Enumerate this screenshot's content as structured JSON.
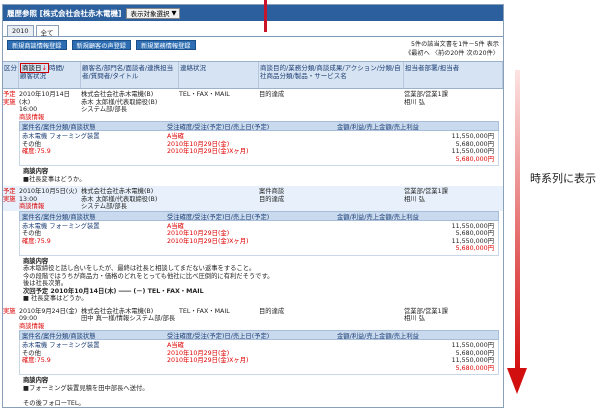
{
  "window": {
    "title": "履歴参照 [株式会社会社赤木電機]",
    "select_label": "表示対象選択"
  },
  "tabs": [
    "2010",
    "全て"
  ],
  "toolbar": {
    "buttons": [
      "新規商談情報登録",
      "新規顧客の声登録",
      "新規業務情報登録"
    ],
    "count": "5件の該当文書を1件－5件 表示",
    "nav": "《最初へ 〈前の20件 次の20件〉"
  },
  "header": {
    "col_kubun": "区分",
    "col_date_label": "商談日",
    "col_date_rest": "時間/",
    "col_status": "顧客状況",
    "col_customer": "顧客名/部門名/面談者/連携担当者/質問者/タイトル",
    "col_means": "連絡状況",
    "col_purpose": "商談目的/業務分類/商談成果/アクション/分類/自社商品分類/製品・サービス名",
    "col_dept": "担当者部署/担当者"
  },
  "records": [
    {
      "kubun": "予定 実施",
      "date": "2010年10月14日(木)",
      "time": "16:00",
      "status": "商談情報",
      "customer": [
        "株式会社会社赤木電機(B)",
        "赤木 太郎様/代表取締役(B)",
        "システム部/部長"
      ],
      "means": "TEL・FAX・MAIL",
      "purpose": [
        "目的達成"
      ],
      "dept": [
        "営業部/営業1課",
        "相川 弘"
      ],
      "sub": [
        {
          "item": "赤木電機 フォーミング装置",
          "sub2": "その他",
          "prob": "確度:75.9",
          "order": "A当確",
          "dates": [
            "2010年10月29日(金)",
            "2010年10月29日(金)Xヶ月)"
          ],
          "amounts": [
            "11,550,000円",
            "5,680,000円",
            "11,550,000円",
            "5,680,000円"
          ]
        }
      ],
      "notes": [
        "商談内容",
        "■社長変事はどうか。"
      ]
    },
    {
      "kubun": "予定 実施",
      "date": "2010年10月5日(火)",
      "time": "13:00",
      "status": "商談情報",
      "customer": [
        "株式会社会社赤木電機(B)",
        "赤木 太郎様/代表取締役(B)",
        "システム部/部長"
      ],
      "means": "",
      "purpose": [
        "案件商談",
        "目的達成"
      ],
      "dept": [
        "営業部/営業1課",
        "相川 弘"
      ],
      "sub": [
        {
          "item": "赤木電機 フォーミング装置",
          "sub2": "その他",
          "prob": "確度:75.9",
          "order": "A当確",
          "dates": [
            "2010年10月29日(金)",
            "2010年10月29日(金)Xヶ月)"
          ],
          "amounts": [
            "11,550,000円",
            "5,680,000円",
            "11,550,000円",
            "5,680,000円"
          ]
        }
      ],
      "notes": [
        "商談内容",
        "赤木取締役と話し合いをしたが、最終は社長と相談してまだない返事をすること。",
        "今の段階ではうちが商品力・価格のどれをとっても他社に比べ圧倒的に有利だそうです。",
        "後は社長次第。",
        "次回予定 2010年10月14日(木) ―― (－) TEL・FAX・MAIL",
        "■ 社長変事はどうか。"
      ]
    },
    {
      "kubun": "実施",
      "date": "2010年9月24日(金)",
      "time": "09:00",
      "status": "商談情報",
      "customer": [
        "株式会社会社赤木電機(B)",
        "田中 真一様/情報システム部/部長"
      ],
      "means": "TEL・FAX・MAIL",
      "purpose": [
        "目的達成"
      ],
      "dept": [
        "営業部/営業1課",
        "相川 弘"
      ],
      "sub": [
        {
          "item": "赤木電機 フォーミング装置",
          "sub2": "その他",
          "prob": "確度:75.9",
          "order": "A当確",
          "dates": [
            "2010年10月29日(金)",
            "2010年10月29日(金)Xヶ月)"
          ],
          "amounts": [
            "11,550,000円",
            "5,680,000円",
            "11,550,000円",
            "5,680,000円"
          ]
        }
      ],
      "notes": [
        "商談内容",
        "■フォーミング装置見積を田中部長へ送付。",
        "",
        "その後フォローTEL。"
      ]
    }
  ],
  "subheader": {
    "c1": "案件名/案件分類/商談状態",
    "c2": "受注確度/受注(予定)日/売上日(予定)",
    "c3": "金額/利益/売上金額/売上利益"
  },
  "side_label": "時系列に表示"
}
